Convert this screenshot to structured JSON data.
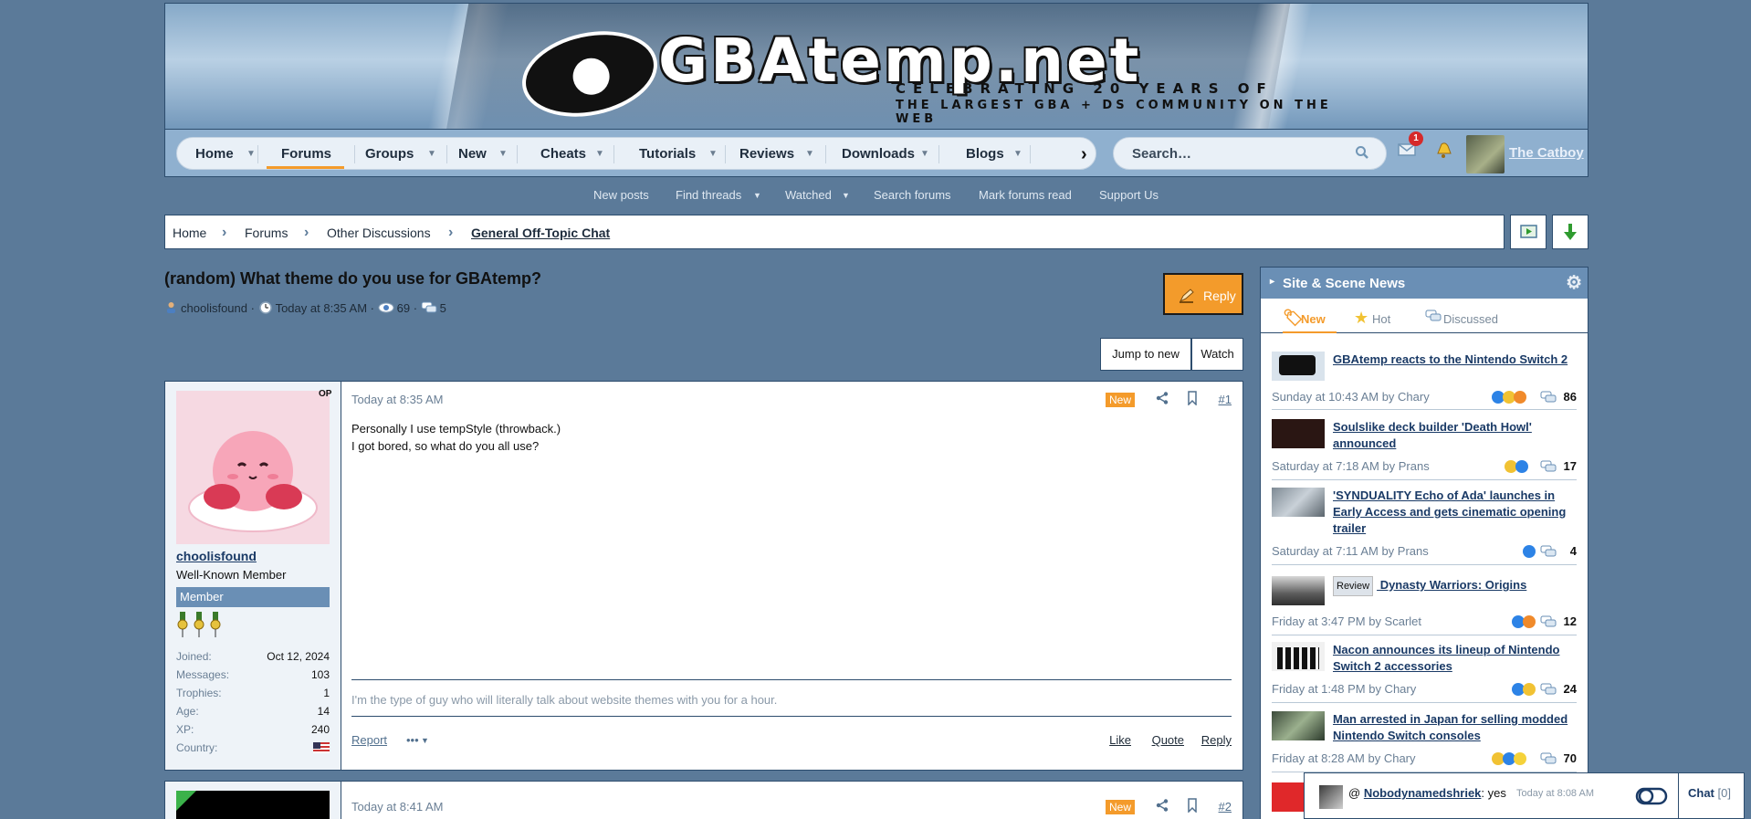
{
  "header": {
    "logo_text": "GBAtemp.net",
    "logo_sub1": "CELEBRATING 20 YEARS OF",
    "logo_sub2": "THE LARGEST GBA + DS COMMUNITY ON THE WEB"
  },
  "nav": {
    "items": [
      {
        "label": "Home"
      },
      {
        "label": "Forums"
      },
      {
        "label": "Groups"
      },
      {
        "label": "New"
      },
      {
        "label": "Cheats"
      },
      {
        "label": "Tutorials"
      },
      {
        "label": "Reviews"
      },
      {
        "label": "Downloads"
      },
      {
        "label": "Blogs"
      }
    ],
    "active": "Forums",
    "search_placeholder": "Search…",
    "inbox_count": "1",
    "username": "The Catboy"
  },
  "subnav": {
    "items": [
      "New posts",
      "Find threads",
      "Watched",
      "Search forums",
      "Mark forums read",
      "Support Us"
    ]
  },
  "breadcrumb": [
    "Home",
    "Forums",
    "Other Discussions",
    "General Off-Topic Chat"
  ],
  "thread": {
    "title": "(random) What theme do you use for GBAtemp?",
    "author": "choolisfound",
    "time": "Today at 8:35 AM",
    "views": "69",
    "replies": "5",
    "reply_label": "Reply",
    "jump_label": "Jump to new",
    "watch_label": "Watch"
  },
  "posts": [
    {
      "op": "OP",
      "username": "choolisfound",
      "user_title": "Well-Known Member",
      "banner": "Member",
      "stats": [
        {
          "k": "Joined:",
          "v": "Oct 12, 2024"
        },
        {
          "k": "Messages:",
          "v": "103"
        },
        {
          "k": "Trophies:",
          "v": "1"
        },
        {
          "k": "Age:",
          "v": "14"
        },
        {
          "k": "XP:",
          "v": "240"
        },
        {
          "k": "Country:",
          "v": ""
        }
      ],
      "time": "Today at 8:35 AM",
      "new_badge": "New",
      "number": "#1",
      "line1": "Personally I use tempStyle (throwback.)",
      "line2": "I got bored, so what do you all use?",
      "signature": "I'm the type of guy who will literally talk about website themes with you for a hour.",
      "report": "Report",
      "more": "•••",
      "like": "Like",
      "quote": "Quote",
      "reply": "Reply"
    },
    {
      "time": "Today at 8:41 AM",
      "new_badge": "New",
      "number": "#2"
    }
  ],
  "sidebar": {
    "title": "Site & Scene News",
    "tabs": [
      "New",
      "Hot",
      "Discussed"
    ],
    "news": [
      {
        "title": "GBAtemp reacts to the Nintendo Switch 2",
        "by": "Sunday at 10:43 AM by Chary",
        "count": "86"
      },
      {
        "title": "Soulslike deck builder 'Death Howl' announced",
        "by": "Saturday at 7:18 AM by Prans",
        "count": "17"
      },
      {
        "title": "'SYNDUALITY Echo of Ada' launches in Early Access and gets cinematic opening trailer",
        "by": "Saturday at 7:11 AM by Prans",
        "count": "4"
      },
      {
        "tag": "Review",
        "title": " Dynasty Warriors: Origins",
        "by": "Friday at 3:47 PM by Scarlet",
        "count": "12"
      },
      {
        "title": "Nacon announces its lineup of Nintendo Switch 2 accessories",
        "by": "Friday at 1:48 PM by Chary",
        "count": "24"
      },
      {
        "title": "Man arrested in Japan for selling modded Nintendo Switch consoles",
        "by": "Friday at 8:28 AM by Chary",
        "count": "70"
      }
    ]
  },
  "chat": {
    "at": "@",
    "user": "Nobodynamedshriek",
    "text": ": yes",
    "time": "Today at 8:08 AM",
    "label": "Chat",
    "count": "[0]"
  },
  "colors": {
    "background": "#5b7a99",
    "accent": "#f49b2b",
    "panel_header": "#6a8fb5",
    "link": "#1a3a66"
  }
}
